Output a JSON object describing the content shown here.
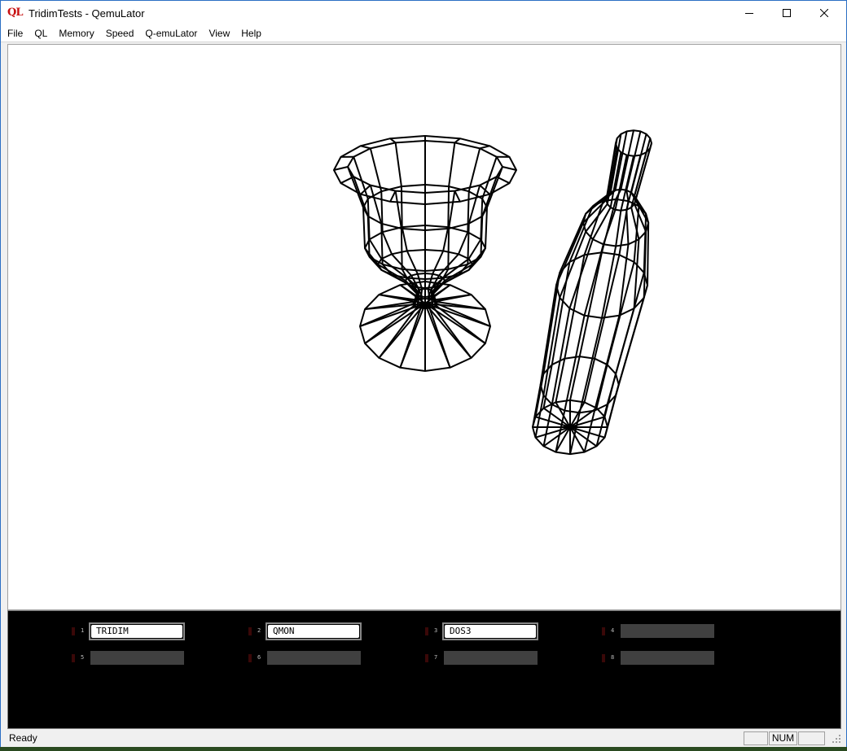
{
  "window": {
    "title": "TridimTests - QemuLator",
    "app_icon_text": "QL"
  },
  "menu": [
    "File",
    "QL",
    "Memory",
    "Speed",
    "Q-emuLator",
    "View",
    "Help"
  ],
  "ql_slots": [
    {
      "num": "1",
      "label": "TRIDIM"
    },
    {
      "num": "2",
      "label": "QMON"
    },
    {
      "num": "3",
      "label": "DOS3"
    },
    {
      "num": "4",
      "label": ""
    },
    {
      "num": "5",
      "label": ""
    },
    {
      "num": "6",
      "label": ""
    },
    {
      "num": "7",
      "label": ""
    },
    {
      "num": "8",
      "label": ""
    }
  ],
  "status": {
    "text": "Ready",
    "panes": [
      "",
      "NUM",
      ""
    ]
  },
  "colors": {
    "titlebar_border": "#2b6fc4",
    "ql_bar": "#000000",
    "empty_slot": "#404040",
    "icon_red": "#c81010"
  }
}
